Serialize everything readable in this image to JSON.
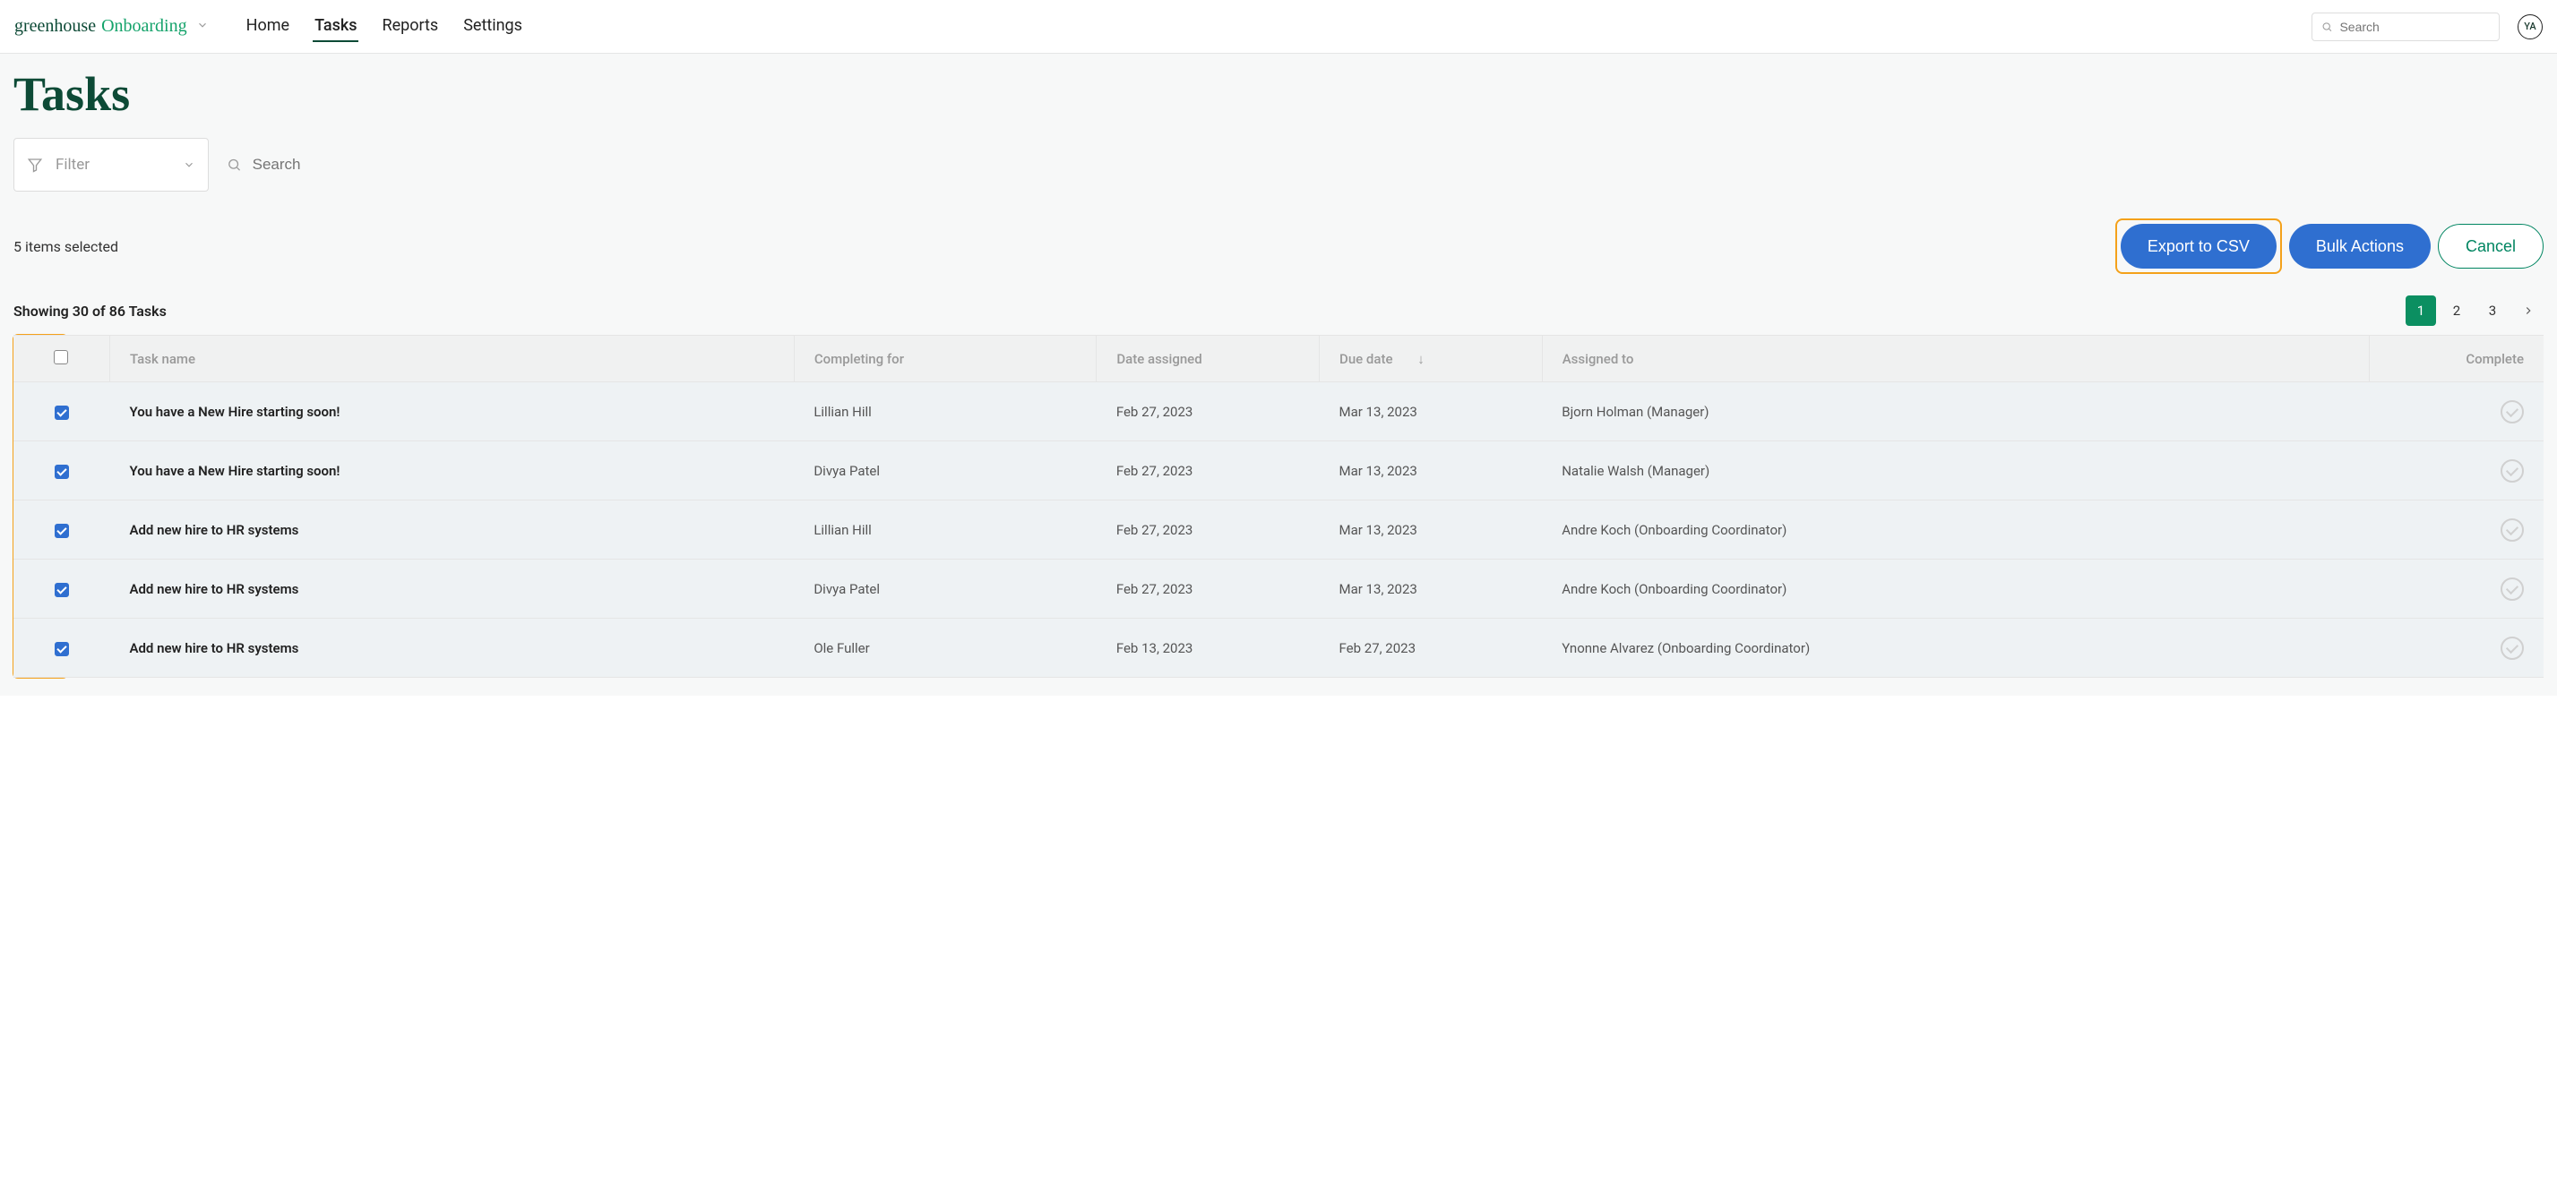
{
  "brand": {
    "greenhouse": "greenhouse",
    "onboarding": "Onboarding"
  },
  "nav": {
    "home": "Home",
    "tasks": "Tasks",
    "reports": "Reports",
    "settings": "Settings",
    "search_placeholder": "Search",
    "avatar_initials": "YA"
  },
  "page": {
    "title": "Tasks",
    "filter_label": "Filter",
    "search_placeholder": "Search",
    "items_selected": "5 items selected",
    "export_csv": "Export to CSV",
    "bulk_actions": "Bulk Actions",
    "cancel": "Cancel",
    "showing": "Showing 30 of 86 Tasks",
    "pages": {
      "p1": "1",
      "p2": "2",
      "p3": "3"
    }
  },
  "table": {
    "headers": {
      "task_name": "Task name",
      "completing_for": "Completing for",
      "date_assigned": "Date assigned",
      "due_date": "Due date",
      "assigned_to": "Assigned to",
      "complete": "Complete"
    },
    "rows": [
      {
        "task_name": "You have a New Hire starting soon!",
        "completing_for": "Lillian Hill",
        "date_assigned": "Feb 27, 2023",
        "due_date": "Mar 13, 2023",
        "assigned_to": "Bjorn Holman (Manager)"
      },
      {
        "task_name": "You have a New Hire starting soon!",
        "completing_for": "Divya Patel",
        "date_assigned": "Feb 27, 2023",
        "due_date": "Mar 13, 2023",
        "assigned_to": "Natalie Walsh (Manager)"
      },
      {
        "task_name": "Add new hire to HR systems",
        "completing_for": "Lillian Hill",
        "date_assigned": "Feb 27, 2023",
        "due_date": "Mar 13, 2023",
        "assigned_to": "Andre Koch (Onboarding Coordinator)"
      },
      {
        "task_name": "Add new hire to HR systems",
        "completing_for": "Divya Patel",
        "date_assigned": "Feb 27, 2023",
        "due_date": "Mar 13, 2023",
        "assigned_to": "Andre Koch (Onboarding Coordinator)"
      },
      {
        "task_name": "Add new hire to HR systems",
        "completing_for": "Ole Fuller",
        "date_assigned": "Feb 13, 2023",
        "due_date": "Feb 27, 2023",
        "assigned_to": "Ynonne Alvarez (Onboarding Coordinator)"
      }
    ]
  }
}
